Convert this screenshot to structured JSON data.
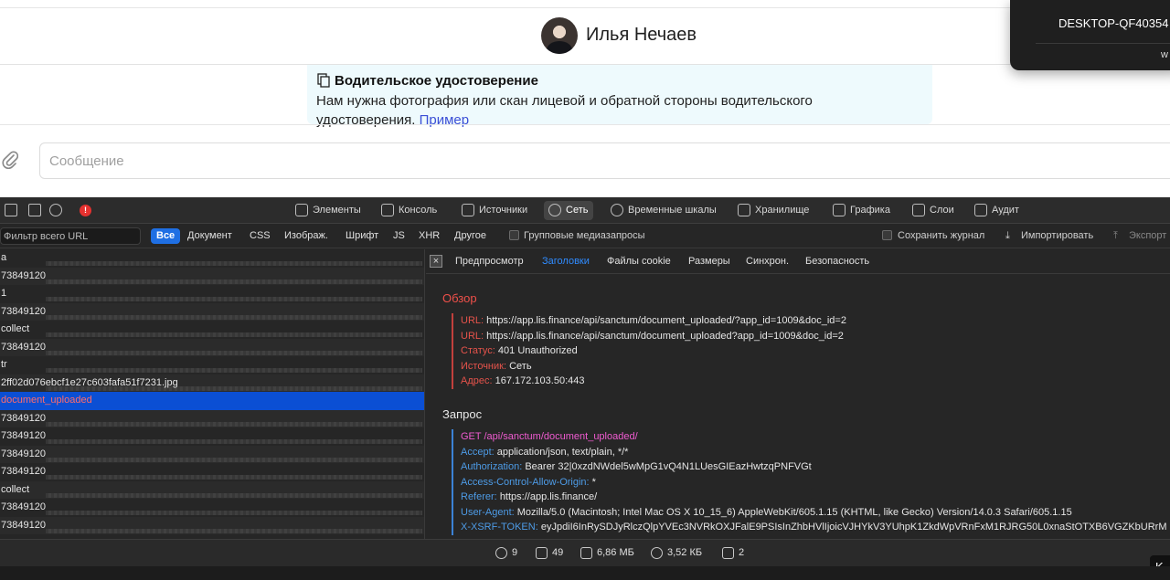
{
  "chat": {
    "contact_name": "Илья Нечаев",
    "doc_title": "Водительское удостоверение",
    "doc_text": "Нам нужна фотография или скан лицевой и обратной стороны водительского удостоверения.",
    "doc_link": "Пример",
    "message_placeholder": "Сообщение"
  },
  "popup": {
    "device_name": "DESKTOP-QF40354",
    "device_sub": "w"
  },
  "devtools": {
    "error_count": "!",
    "tabs": [
      {
        "label": "Элементы",
        "icon": "elements-icon"
      },
      {
        "label": "Консоль",
        "icon": "console-icon"
      },
      {
        "label": "Источники",
        "icon": "sources-icon"
      },
      {
        "label": "Сеть",
        "icon": "network-icon",
        "active": true
      },
      {
        "label": "Временные шкалы",
        "icon": "timelines-icon"
      },
      {
        "label": "Хранилище",
        "icon": "storage-icon"
      },
      {
        "label": "Графика",
        "icon": "graphics-icon"
      },
      {
        "label": "Слои",
        "icon": "layers-icon"
      },
      {
        "label": "Аудит",
        "icon": "audit-icon"
      }
    ],
    "filter": {
      "url_placeholder": "Фильтр всего URL",
      "types": [
        "Все",
        "Документ",
        "CSS",
        "Изображ.",
        "Шрифт",
        "JS",
        "XHR",
        "Другое"
      ],
      "group_media": "Групповые медиазапросы",
      "preserve_log": "Сохранить журнал",
      "import": "Импортировать",
      "export": "Экспорт"
    },
    "requests": [
      {
        "name": "а"
      },
      {
        "name": "73849120"
      },
      {
        "name": "1"
      },
      {
        "name": "73849120"
      },
      {
        "name": "collect"
      },
      {
        "name": "73849120"
      },
      {
        "name": "tr"
      },
      {
        "name": "2ff02d076ebcf1e27c603fafa51f7231.jpg"
      },
      {
        "name": "document_uploaded",
        "selected": true
      },
      {
        "name": "73849120"
      },
      {
        "name": "73849120"
      },
      {
        "name": "73849120"
      },
      {
        "name": "73849120"
      },
      {
        "name": "collect"
      },
      {
        "name": "73849120"
      },
      {
        "name": "73849120"
      }
    ],
    "detail_tabs": [
      "Предпросмотр",
      "Заголовки",
      "Файлы cookie",
      "Размеры",
      "Синхрон.",
      "Безопасность"
    ],
    "overview": {
      "title": "Обзор",
      "rows": [
        {
          "k": "URL:",
          "v": "https://app.lis.finance/api/sanctum/document_uploaded/?app_id=1009&doc_id=2"
        },
        {
          "k": "URL:",
          "v": "https://app.lis.finance/api/sanctum/document_uploaded?app_id=1009&doc_id=2"
        },
        {
          "k": "Статус:",
          "v": "401 Unauthorized"
        },
        {
          "k": "Источник:",
          "v": "Сеть"
        },
        {
          "k": "Адрес:",
          "v": "167.172.103.50:443"
        }
      ]
    },
    "request": {
      "title": "Запрос",
      "request_line": "GET /api/sanctum/document_uploaded/",
      "rows": [
        {
          "k": "Accept:",
          "v": "application/json, text/plain, */*"
        },
        {
          "k": "Authorization:",
          "v": "Bearer 32|0xzdNWdel5wMpG1vQ4N1LUesGIEazHwtzqPNFVGt"
        },
        {
          "k": "Access-Control-Allow-Origin:",
          "v": "*"
        },
        {
          "k": "Referer:",
          "v": "https://app.lis.finance/"
        },
        {
          "k": "User-Agent:",
          "v": "Mozilla/5.0 (Macintosh; Intel Mac OS X 10_15_6) AppleWebKit/605.1.15 (KHTML, like Gecko) Version/14.0.3 Safari/605.1.15"
        },
        {
          "k": "X-XSRF-TOKEN:",
          "v": "eyJpdiI6InRySDJyRlczQlpYVEc3NVRkOXJFalE9PSIsInZhbHVlIjoicVJHYkV3YUhpK1ZkdWpVRnFxM1RJRG50L0xnaStOTXB6VGZKbURrM"
        }
      ]
    },
    "status": {
      "requests": "9",
      "resources": "49",
      "transferred": "6,86 МБ",
      "size": "3,52 КБ",
      "redirects": "2"
    },
    "key_hint": "K"
  }
}
